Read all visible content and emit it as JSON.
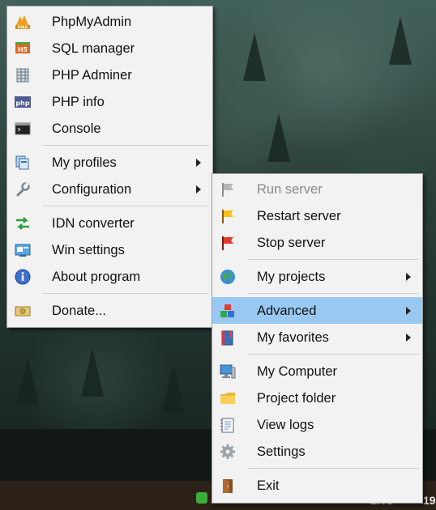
{
  "left_menu": {
    "items": [
      {
        "label": "PhpMyAdmin",
        "icon": "pma-logo-icon"
      },
      {
        "label": "SQL manager",
        "icon": "html5-badge-icon"
      },
      {
        "label": "PHP Adminer",
        "icon": "database-grid-icon"
      },
      {
        "label": "PHP info",
        "icon": "php-badge-icon"
      },
      {
        "label": "Console",
        "icon": "console-icon"
      },
      {
        "label": "My profiles",
        "icon": "profiles-icon",
        "submenu": true
      },
      {
        "label": "Configuration",
        "icon": "wrench-icon",
        "submenu": true
      },
      {
        "label": "IDN converter",
        "icon": "converter-arrows-icon"
      },
      {
        "label": "Win settings",
        "icon": "settings-window-icon"
      },
      {
        "label": "About program",
        "icon": "info-icon"
      },
      {
        "label": "Donate...",
        "icon": "donate-icon"
      }
    ]
  },
  "right_menu": {
    "items": [
      {
        "label": "Run server",
        "icon": "gray-flag-icon",
        "disabled": true
      },
      {
        "label": "Restart server",
        "icon": "yellow-flag-icon"
      },
      {
        "label": "Stop server",
        "icon": "red-flag-icon"
      },
      {
        "label": "My projects",
        "icon": "globe-icon",
        "submenu": true
      },
      {
        "label": "Advanced",
        "icon": "blocks-icon",
        "submenu": true,
        "highlighted": true
      },
      {
        "label": "My favorites",
        "icon": "bookmark-book-icon",
        "submenu": true
      },
      {
        "label": "My Computer",
        "icon": "computer-icon"
      },
      {
        "label": "Project folder",
        "icon": "folder-icon"
      },
      {
        "label": "View logs",
        "icon": "log-notepad-icon"
      },
      {
        "label": "Settings",
        "icon": "gear-icon"
      },
      {
        "label": "Exit",
        "icon": "exit-door-icon"
      }
    ]
  },
  "taskbar": {
    "language": "ENG",
    "clock_fragment": "19"
  },
  "colors": {
    "menu_background": "#f2f2f2",
    "highlight": "#99c9f2",
    "disabled_text": "#8a8a8a"
  }
}
